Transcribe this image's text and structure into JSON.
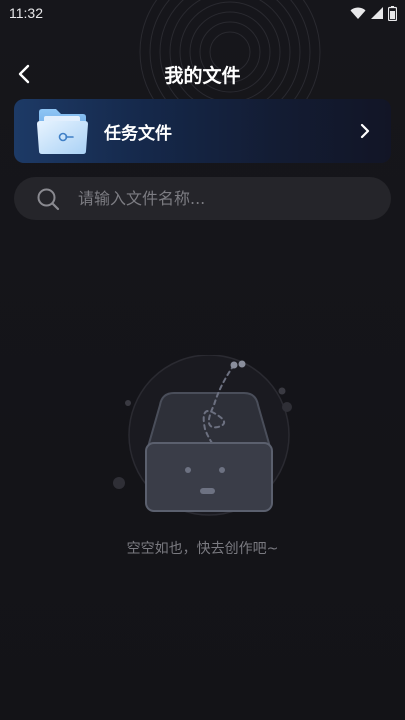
{
  "status_bar": {
    "time": "11:32",
    "icons": [
      "wifi-icon",
      "cell-signal-icon",
      "battery-icon"
    ]
  },
  "header": {
    "back_icon": "chevron-left-icon",
    "title": "我的文件"
  },
  "task_files": {
    "icon": "folder-icon",
    "label": "任务文件",
    "chevron_icon": "chevron-right-icon"
  },
  "search": {
    "icon": "search-icon",
    "value": "",
    "placeholder": "请输入文件名称..."
  },
  "empty_state": {
    "illustration": "empty-inbox-illustration",
    "text": "空空如也，快去创作吧~"
  },
  "colors": {
    "background": "#141418",
    "card_gradient_start": "#1d3a66",
    "card_gradient_end": "#121526",
    "search_background": "#25252a",
    "muted_text": "#7a7a80",
    "primary_text": "#ffffff"
  }
}
